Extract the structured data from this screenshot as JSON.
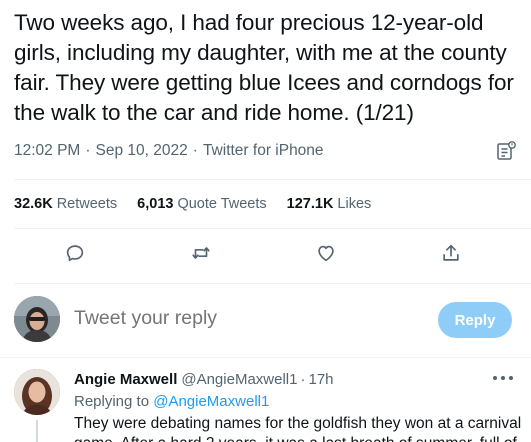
{
  "tweet": {
    "text": "Two weeks ago, I had four precious 12-year-old girls, including my daughter, with me at the county fair. They were getting blue Icees and corndogs for the walk to the car and ride home. (1/21)",
    "time": "12:02 PM",
    "date": "Sep 10, 2022",
    "separator": "·",
    "source": "Twitter for iPhone",
    "analytics_icon": "analytics-icon"
  },
  "stats": {
    "retweets_count": "32.6K",
    "retweets_label": "Retweets",
    "quotes_count": "6,013",
    "quotes_label": "Quote Tweets",
    "likes_count": "127.1K",
    "likes_label": "Likes"
  },
  "actions": {
    "icons": [
      "reply-icon",
      "retweet-icon",
      "like-icon",
      "share-icon"
    ]
  },
  "reply_box": {
    "placeholder": "Tweet your reply",
    "button_label": "Reply"
  },
  "reply_tweet": {
    "name": "Angie Maxwell",
    "handle": "@AngieMaxwell1",
    "separator": "·",
    "time": "17h",
    "replying_to_label": "Replying to",
    "replying_to_handle": "@AngieMaxwell1",
    "text_line1": "They were debating names for the goldfish they won at a carnival",
    "text_line2": "game. After a hard 2 years, it was a last breath of summer, full of"
  },
  "colors": {
    "text": "#0f1419",
    "secondary": "#536471",
    "accent": "#1d9bf0",
    "reply_button_disabled": "#8ecdf7"
  }
}
